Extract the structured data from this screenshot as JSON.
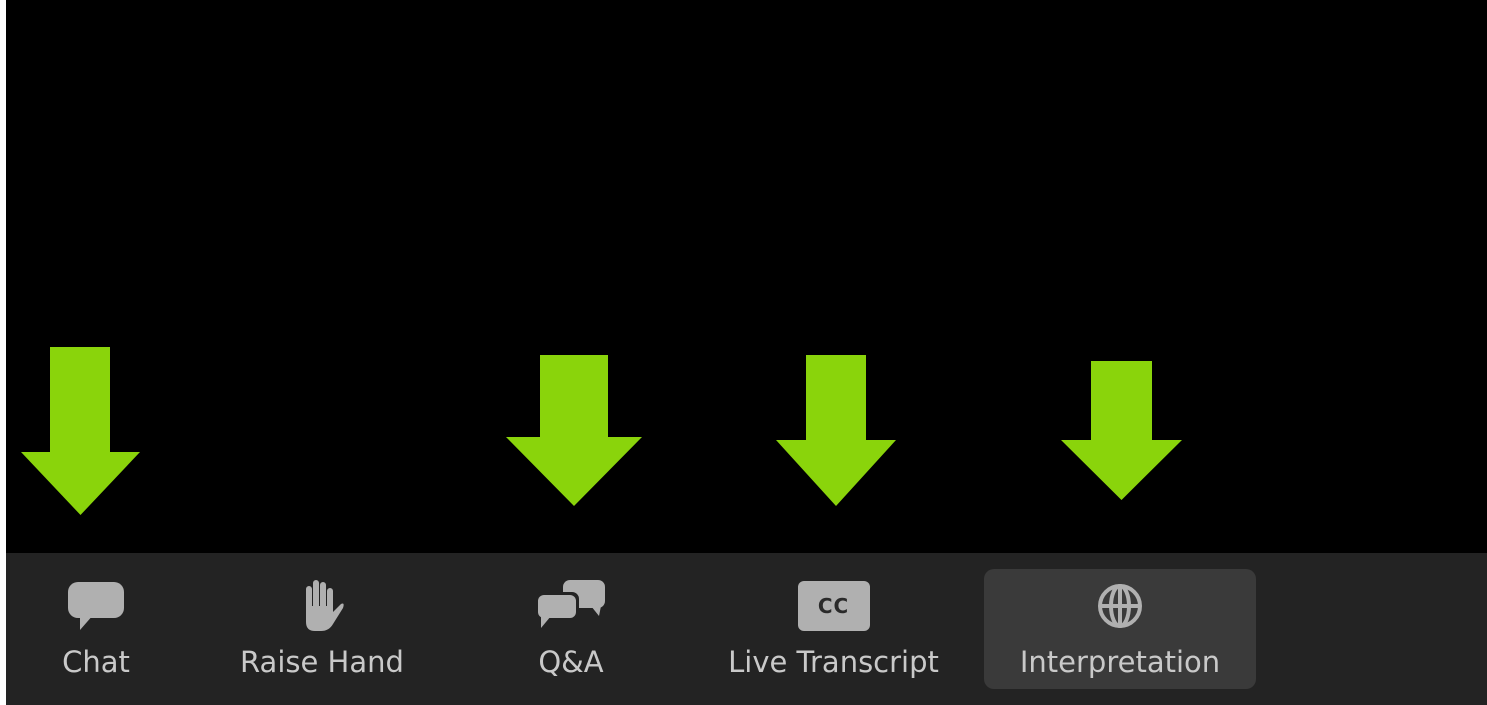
{
  "colors": {
    "video_background": "#000000",
    "toolbar_background": "#232323",
    "active_button_background": "#3a3a3a",
    "label_text": "#c9c9c9",
    "icon_fill": "#b0b0b0",
    "annotation_arrow": "#8ad40b"
  },
  "toolbar": {
    "buttons": [
      {
        "label": "Chat",
        "icon": "chat-bubble-icon",
        "active": false
      },
      {
        "label": "Raise Hand",
        "icon": "raise-hand-icon",
        "active": false
      },
      {
        "label": "Q&A",
        "icon": "qa-bubbles-icon",
        "active": false
      },
      {
        "label": "Live Transcript",
        "icon": "closed-captions-icon",
        "active": false,
        "icon_text": "CC"
      },
      {
        "label": "Interpretation",
        "icon": "globe-icon",
        "active": true
      }
    ]
  },
  "annotations": {
    "arrows": [
      {
        "points_to": "Chat",
        "icon": "down-arrow-icon"
      },
      {
        "points_to": "Q&A",
        "icon": "down-arrow-icon"
      },
      {
        "points_to": "Live Transcript",
        "icon": "down-arrow-icon"
      },
      {
        "points_to": "Interpretation",
        "icon": "down-arrow-icon"
      }
    ]
  }
}
